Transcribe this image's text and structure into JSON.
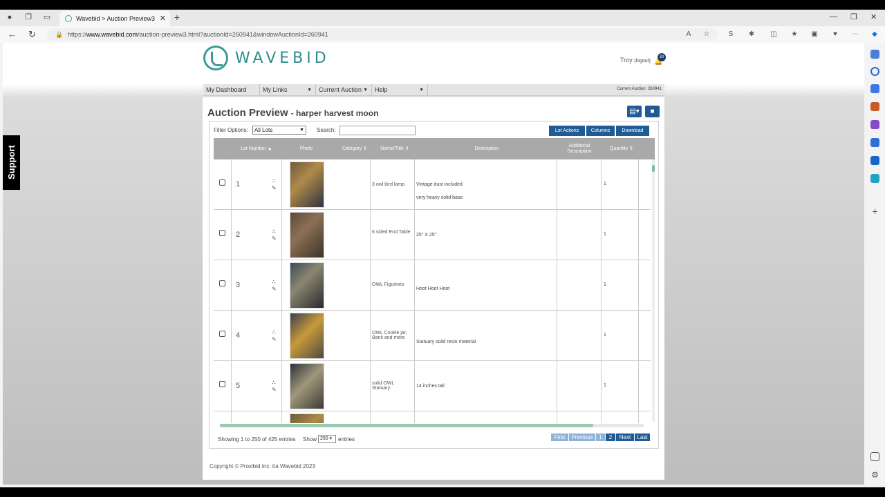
{
  "browser": {
    "tab_title": "Wavebid > Auction Preview3",
    "url_prefix": "https://",
    "url_domain": "www.wavebid.com",
    "url_path": "/auction-preview3.html?auctionId=260941&windowAuctionId=260941"
  },
  "support_label": "Support",
  "brand": "WAVEBID",
  "user": {
    "name": "Troy",
    "logout": "(logout)",
    "notifications": "30"
  },
  "menu": {
    "items": [
      "My Dashboard",
      "My Links",
      "Current Auction",
      "Help"
    ],
    "current_auction": "Current Auction: 260941"
  },
  "page": {
    "title": "Auction Preview",
    "subtitle": "- harper harvest moon"
  },
  "filter": {
    "label": "Filter Options:",
    "value": "All Lots"
  },
  "search": {
    "label": "Search:",
    "value": ""
  },
  "actions": {
    "lot_actions": "Lot Actions",
    "columns": "Columns",
    "download": "Download"
  },
  "table": {
    "headers": [
      "Lot Number",
      "Photo",
      "Category",
      "Name/Title",
      "Description",
      "Additional Description",
      "Quantity"
    ],
    "rows": [
      {
        "lot": "1",
        "name": "3 owl bird lamp",
        "desc1": "Vintage dust included",
        "desc2": "very heavy solid base",
        "qty": "1"
      },
      {
        "lot": "2",
        "name": "6 sided End Table",
        "desc1": "25\" X 25\"",
        "desc2": "",
        "qty": "1"
      },
      {
        "lot": "3",
        "name": "OWL Figurines",
        "desc1": "Hoot Hoot Hoot",
        "desc2": "",
        "qty": "1"
      },
      {
        "lot": "4",
        "name": "OWL Cookie jar, Bank and more",
        "desc1": "Statuary solid resin material",
        "desc2": "",
        "qty": "1"
      },
      {
        "lot": "5",
        "name": "solid OWL Statuary",
        "desc1": "14 inches tall",
        "desc2": "",
        "qty": "1"
      }
    ]
  },
  "footer": {
    "showing": "Showing 1 to 250 of 425 entries",
    "show_label": "Show",
    "show_value": "250",
    "entries_label": "entries",
    "pager": [
      "First",
      "Previous",
      "1",
      "2",
      "Next",
      "Last"
    ],
    "copyright": "Copyright © Proxibid Inc. t/a Wavebid 2023"
  }
}
